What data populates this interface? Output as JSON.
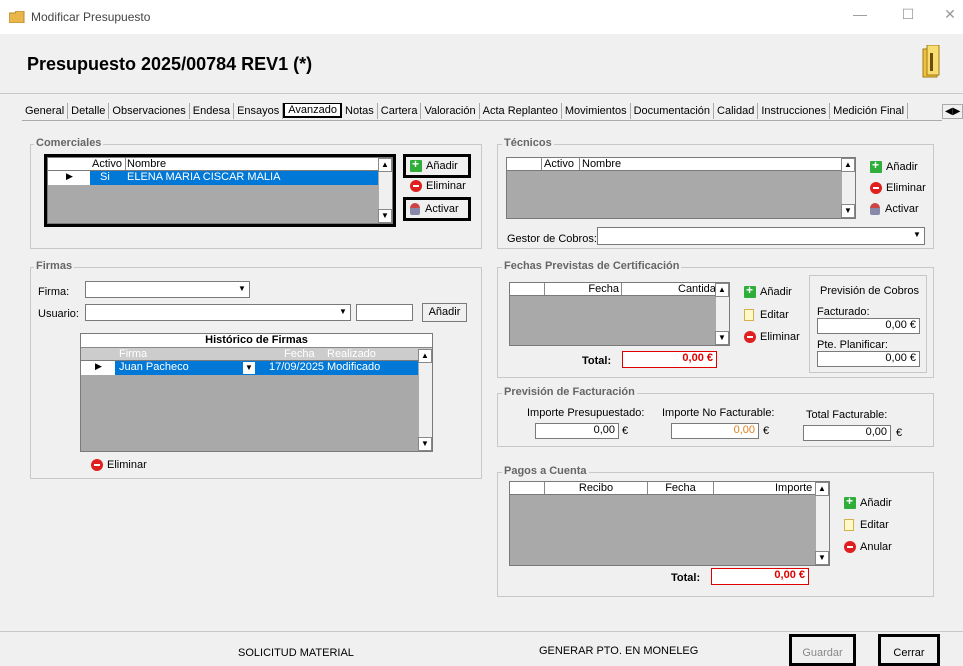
{
  "window": {
    "title": "Modificar Presupuesto",
    "min": "—",
    "max": "☐",
    "close": "✕"
  },
  "header": {
    "title": "Presupuesto 2025/00784 REV1  (*)"
  },
  "tabs": [
    "General",
    "Detalle",
    "Observaciones",
    "Endesa",
    "Ensayos",
    "Avanzado",
    "Notas",
    "Cartera",
    "Valoración",
    "Acta Replanteo",
    "Movimientos",
    "Documentación",
    "Calidad",
    "Instrucciones",
    "Medición Final"
  ],
  "active_tab": "Avanzado",
  "comerciales": {
    "label": "Comerciales",
    "col_activo": "Activo",
    "col_nombre": "Nombre",
    "row": {
      "activo": "Si",
      "nombre": "ELENA MARIA CISCAR MALIA"
    },
    "btn_add": "Añadir",
    "btn_del": "Eliminar",
    "btn_act": "Activar"
  },
  "tecnicos": {
    "label": "Técnicos",
    "col_activo": "Activo",
    "col_nombre": "Nombre",
    "btn_add": "Añadir",
    "btn_del": "Eliminar",
    "btn_act": "Activar",
    "gestor_label": "Gestor de Cobros:"
  },
  "firmas": {
    "label": "Firmas",
    "firma_label": "Firma:",
    "usuario_label": "Usuario:",
    "btn_add": "Añadir",
    "hist_title": "Histórico de Firmas",
    "cols": {
      "firma": "Firma",
      "fecha": "Fecha",
      "realizado": "Realizado"
    },
    "row": {
      "firma": "Juan Pacheco",
      "fecha": "17/09/2025",
      "realizado": "Modificado"
    },
    "btn_del": "Eliminar"
  },
  "certificacion": {
    "label": "Fechas Previstas de Certificación",
    "col_fecha": "Fecha",
    "col_cantidad": "Cantidad",
    "btn_add": "Añadir",
    "btn_edit": "Editar",
    "btn_del": "Eliminar",
    "total_label": "Total:",
    "total": "0,00 €",
    "prevision_title": "Previsión de Cobros",
    "facturado_label": "Facturado:",
    "facturado": "0,00 €",
    "pte_label": "Pte. Planificar:",
    "pte": "0,00 €"
  },
  "facturacion": {
    "label": "Previsión de Facturación",
    "presupuestado_label": "Importe Presupuestado:",
    "presupuestado": "0,00",
    "no_facturable_label": "Importe No Facturable:",
    "no_facturable": "0,00",
    "total_label": "Total Facturable:",
    "total": "0,00",
    "euro": "€"
  },
  "pagos": {
    "label": "Pagos a Cuenta",
    "col_recibo": "Recibo",
    "col_fecha": "Fecha",
    "col_importe": "Importe",
    "btn_add": "Añadir",
    "btn_edit": "Editar",
    "btn_anular": "Anular",
    "total_label": "Total:",
    "total": "0,00 €"
  },
  "footer": {
    "solicitud": "SOLICITUD MATERIAL",
    "generar": "GENERAR PTO. EN MONELEG",
    "guardar": "Guardar",
    "cerrar": "Cerrar"
  },
  "colors": {
    "selection": "#0078d7",
    "grid_bg": "#a9a9a9",
    "total_red": "#e00000"
  },
  "icons": {
    "window": "folder-icon",
    "header": "folder-open-icon"
  }
}
